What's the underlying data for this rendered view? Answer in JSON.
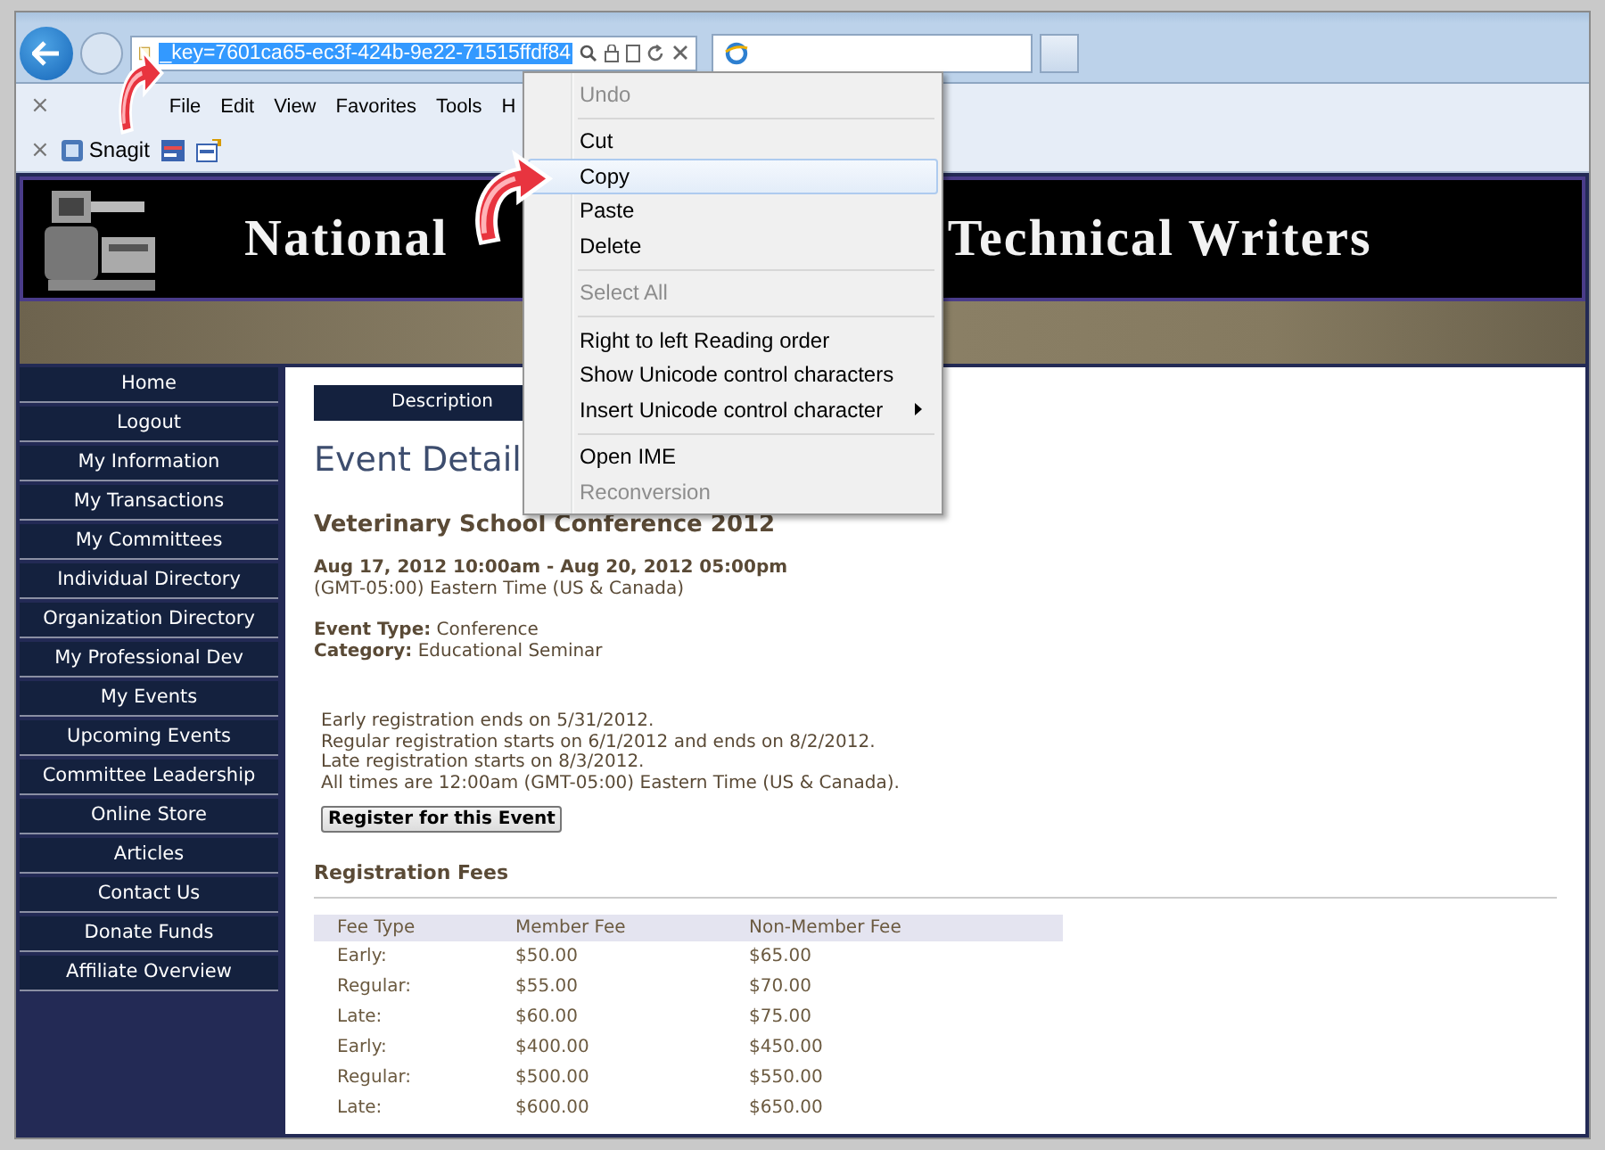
{
  "browser": {
    "address": "_key=7601ca65-ec3f-424b-9e22-71515ffdf84",
    "menu_bar_close": "×",
    "menu_bar": [
      "File",
      "Edit",
      "View",
      "Favorites",
      "Tools",
      "H"
    ],
    "toolbar": {
      "close": "×",
      "snagit_label": "Snagit"
    }
  },
  "banner": {
    "title_left": "National",
    "title_right": "Technical Writers"
  },
  "sidebar": {
    "items": [
      "Home",
      "Logout",
      "My Information",
      "My Transactions",
      "My Committees",
      "Individual Directory",
      "Organization Directory",
      "My Professional Dev",
      "My Events",
      "Upcoming Events",
      "Committee Leadership",
      "Online Store",
      "Articles",
      "Contact Us",
      "Donate Funds",
      "Affiliate Overview"
    ]
  },
  "content": {
    "tab_label": "Description",
    "heading": "Event Detail",
    "event_title": "Veterinary School Conference 2012",
    "date_range": "Aug 17, 2012 10:00am - Aug 20, 2012 05:00pm",
    "timezone": "(GMT-05:00) Eastern Time (US & Canada)",
    "facts": [
      {
        "label": "Event Type:",
        "value": "Conference"
      },
      {
        "label": "Category:",
        "value": "Educational Seminar"
      }
    ],
    "notes": [
      "Early registration ends on 5/31/2012.",
      "Regular registration starts on 6/1/2012 and ends on 8/2/2012.",
      "Late registration starts on 8/3/2012.",
      "All times are 12:00am (GMT-05:00) Eastern Time (US & Canada)."
    ],
    "register_button": "Register for this Event",
    "fees": {
      "title": "Registration Fees",
      "columns": [
        "Fee Type",
        "Member Fee",
        "Non-Member Fee"
      ],
      "rows": [
        [
          "Early:",
          "$50.00",
          "$65.00"
        ],
        [
          "Regular:",
          "$55.00",
          "$70.00"
        ],
        [
          "Late:",
          "$60.00",
          "$75.00"
        ],
        [
          "Early:",
          "$400.00",
          "$450.00"
        ],
        [
          "Regular:",
          "$500.00",
          "$550.00"
        ],
        [
          "Late:",
          "$600.00",
          "$650.00"
        ]
      ]
    }
  },
  "context_menu": {
    "items": [
      {
        "kind": "item",
        "label": "Undo",
        "disabled": true,
        "selected": false
      },
      {
        "kind": "separator"
      },
      {
        "kind": "item",
        "label": "Cut",
        "disabled": false,
        "selected": false
      },
      {
        "kind": "item",
        "label": "Copy",
        "disabled": false,
        "selected": true
      },
      {
        "kind": "item",
        "label": "Paste",
        "disabled": false,
        "selected": false
      },
      {
        "kind": "item",
        "label": "Delete",
        "disabled": false,
        "selected": false
      },
      {
        "kind": "separator"
      },
      {
        "kind": "item",
        "label": "Select All",
        "disabled": true,
        "selected": false
      },
      {
        "kind": "separator"
      },
      {
        "kind": "item",
        "label": "Right to left Reading order",
        "disabled": false,
        "selected": false
      },
      {
        "kind": "item",
        "label": "Show Unicode control characters",
        "disabled": false,
        "selected": false
      },
      {
        "kind": "submenu",
        "label": "Insert Unicode control character",
        "disabled": false,
        "selected": false
      },
      {
        "kind": "separator"
      },
      {
        "kind": "item",
        "label": "Open IME",
        "disabled": false,
        "selected": false
      },
      {
        "kind": "item",
        "label": "Reconversion",
        "disabled": true,
        "selected": false
      }
    ]
  }
}
